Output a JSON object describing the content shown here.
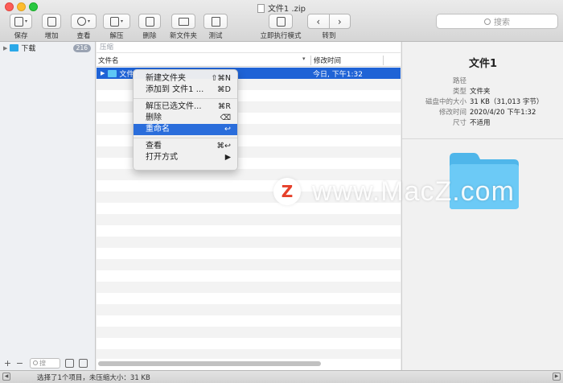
{
  "window": {
    "title": "文件1 .zip"
  },
  "toolbar": {
    "save": "保存",
    "add": "增加",
    "view": "查看",
    "extract": "解压",
    "delete": "删除",
    "new_folder": "新文件夹",
    "test": "测试",
    "instant_mode": "立即执行模式",
    "goto": "转到",
    "search_placeholder": "搜索"
  },
  "sidebar": {
    "items": [
      {
        "label": "下载",
        "badge": "216"
      }
    ],
    "search_placeholder": "搜"
  },
  "filelist": {
    "path": "压缩",
    "col_name": "文件名",
    "col_modified": "修改时间",
    "rows": [
      {
        "name": "文件1",
        "modified": "今日, 下午1:32",
        "selected": true
      }
    ]
  },
  "context_menu": {
    "items": [
      {
        "label": "新建文件夹",
        "shortcut": "⇧⌘N"
      },
      {
        "label": "添加到 文件1 ...",
        "shortcut": "⌘D"
      },
      {
        "label": "解压已选文件...",
        "shortcut": "⌘R"
      },
      {
        "label": "删除",
        "shortcut": "⌫"
      },
      {
        "label": "重命名",
        "shortcut": "↩"
      },
      {
        "label": "查看",
        "shortcut": "⌘↩"
      },
      {
        "label": "打开方式",
        "shortcut": "▶"
      }
    ],
    "highlighted_index": 4
  },
  "info": {
    "title": "文件1",
    "fields": [
      {
        "key": "路径",
        "value": ""
      },
      {
        "key": "类型",
        "value": "文件夹"
      },
      {
        "key": "磁盘中的大小",
        "value": "31 KB（31,013 字节）"
      },
      {
        "key": "修改时间",
        "value": "2020/4/20 下午1:32"
      },
      {
        "key": "尺寸",
        "value": "不适用"
      }
    ]
  },
  "status": {
    "text": "选择了1个项目，未压缩大小：31 KB"
  },
  "watermark": {
    "logo": "Z",
    "text": "www.MacZ.com"
  },
  "colors": {
    "selection": "#1f63d6",
    "menu_highlight": "#2a6ddb",
    "folder": "#2aa8e8"
  }
}
